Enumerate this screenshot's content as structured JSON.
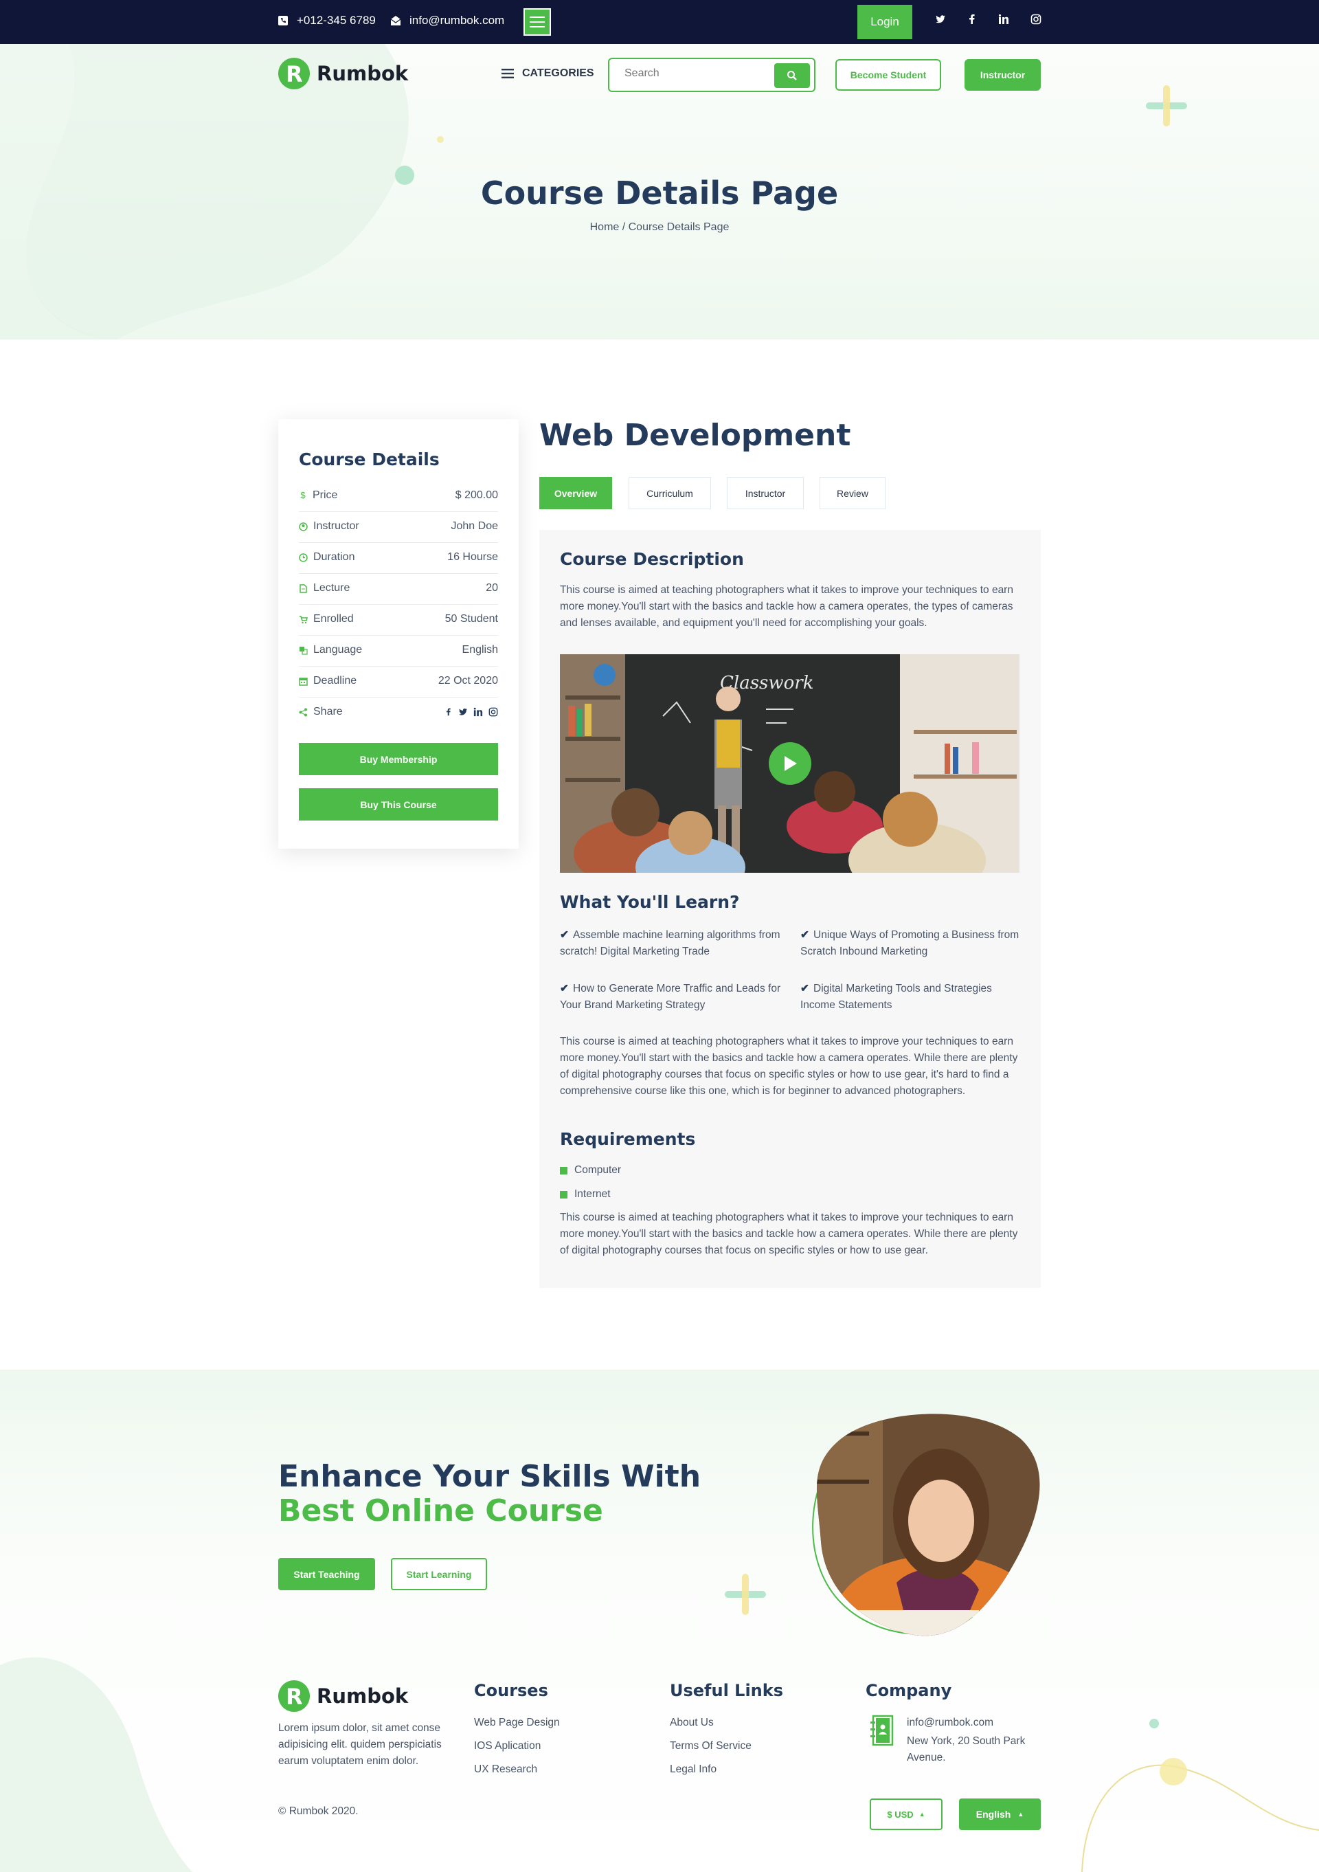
{
  "topbar": {
    "phone": "+012-345 6789",
    "email": "info@rumbok.com",
    "login_label": "Login",
    "social_icons": [
      "twitter-icon",
      "facebook-icon",
      "linkedin-icon",
      "instagram-icon"
    ]
  },
  "nav": {
    "logo_text": "Rumbok",
    "categories_label": "CATEGORIES",
    "search_placeholder": "Search",
    "become_student_label": "Become Student",
    "instructor_label": "Instructor"
  },
  "hero": {
    "title": "Course Details Page",
    "breadcrumb": "Home / Course Details Page"
  },
  "sidebar": {
    "title": "Course Details",
    "rows": [
      {
        "label": "Price",
        "value": "$ 200.00",
        "icon": "dollar-icon"
      },
      {
        "label": "Instructor",
        "value": "John Doe",
        "icon": "user-icon"
      },
      {
        "label": "Duration",
        "value": "16 Hourse",
        "icon": "clock-icon"
      },
      {
        "label": "Lecture",
        "value": "20",
        "icon": "file-icon"
      },
      {
        "label": "Enrolled",
        "value": "50 Student",
        "icon": "cart-icon"
      },
      {
        "label": "Language",
        "value": "English",
        "icon": "language-icon"
      },
      {
        "label": "Deadline",
        "value": "22 Oct 2020",
        "icon": "calendar-icon"
      },
      {
        "label": "Share",
        "value": "",
        "icon": "share-icon"
      }
    ],
    "buy_membership_label": "Buy Membership",
    "buy_course_label": "Buy This Course"
  },
  "course": {
    "title": "Web Development",
    "tabs": [
      "Overview",
      "Curriculum",
      "Instructor",
      "Review"
    ],
    "description_title": "Course Description",
    "description": "This course is aimed at teaching photographers what it takes to improve your techniques to earn more money.You'll start with the basics and tackle how a camera operates, the types of cameras and lenses available, and equipment you'll need for accomplishing your goals.",
    "video_board_text": "Classwork",
    "learn_title": "What You'll Learn?",
    "learn_items": [
      "Assemble machine learning algorithms from scratch! Digital Marketing Trade",
      "Unique Ways of Promoting a Business from Scratch Inbound Marketing",
      "How to Generate More Traffic and Leads for Your Brand Marketing Strategy",
      "Digital Marketing Tools and Strategies Income Statements"
    ],
    "learn_paragraph": "This course is aimed at teaching photographers what it takes to improve your techniques to earn more money.You'll start with the basics and tackle how a camera operates. While there are plenty of digital photography courses that focus on specific styles or how to use gear, it's hard to find a comprehensive course like this one, which is for beginner to advanced photographers.",
    "requirements_title": "Requirements",
    "requirements": [
      "Computer",
      "Internet"
    ],
    "requirements_paragraph": "This course is aimed at teaching photographers what it takes to improve your techniques to earn more money.You'll start with the basics and tackle how a camera operates. While there are plenty of digital photography courses that focus on specific styles or how to use gear."
  },
  "cta": {
    "title_line1": "Enhance Your Skills With",
    "title_line2": "Best Online Course",
    "start_teaching_label": "Start Teaching",
    "start_learning_label": "Start Learning"
  },
  "footer": {
    "logo_text": "Rumbok",
    "about": "Lorem ipsum dolor, sit amet conse adipisicing elit. quidem perspiciatis earum voluptatem enim dolor.",
    "courses_title": "Courses",
    "courses": [
      "Web Page Design",
      "IOS Aplication",
      "UX Research"
    ],
    "links_title": "Useful Links",
    "links": [
      "About Us",
      "Terms Of Service",
      "Legal Info"
    ],
    "company_title": "Company",
    "company_email": "info@rumbok.com",
    "company_address": "New York, 20 South Park Avenue.",
    "copyright": "© Rumbok 2020.",
    "currency_label": "$ USD",
    "language_label": "English"
  },
  "colors": {
    "accent": "#4cbb47",
    "navy": "#0f1638",
    "heading": "#243b5c"
  }
}
